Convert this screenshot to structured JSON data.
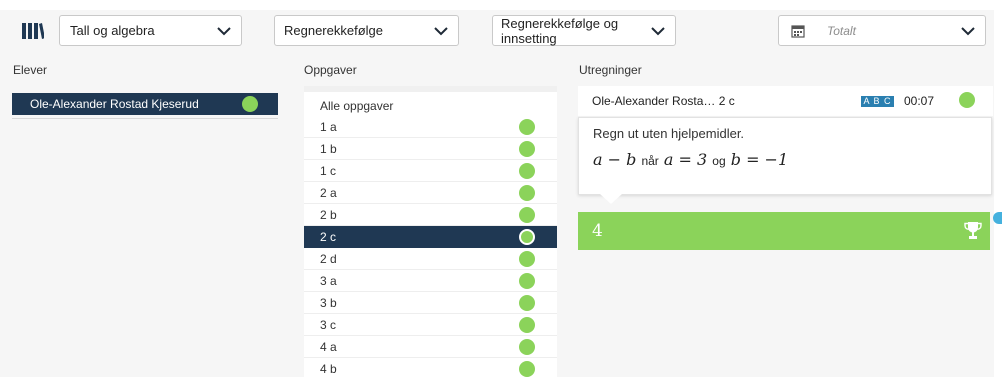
{
  "toolbar": {
    "subject": "Tall og algebra",
    "topic": "Regnerekkefølge",
    "subtopic": "Regnerekkefølge og innsetting",
    "period_placeholder": "Totalt"
  },
  "headers": {
    "students": "Elever",
    "tasks": "Oppgaver",
    "calculations": "Utregninger"
  },
  "students": [
    {
      "name": "Ole-Alexander Rostad Kjeserud",
      "status": "correct"
    }
  ],
  "tasks": {
    "all_label": "Alle oppgaver",
    "selected": "2 c",
    "items": [
      "1 a",
      "1 b",
      "1 c",
      "2 a",
      "2 b",
      "2 c",
      "2 d",
      "3 a",
      "3 b",
      "3 c",
      "4 a",
      "4 b"
    ]
  },
  "calculation": {
    "student_task": "Ole-Alexander Rosta… 2 c",
    "input_mode_badge": "A B C",
    "time": "00:07",
    "question_text": "Regn ut uten hjelpemidler.",
    "question_math": {
      "expr": "a − b",
      "word_when": "når",
      "cond1": "a = 3",
      "word_and": "og",
      "cond2": "b = −1"
    },
    "answer": "4"
  },
  "colors": {
    "navy": "#1f3853",
    "green": "#8bd35a",
    "badge_blue": "#2a7fb0",
    "accent_blue": "#45b1de"
  },
  "icons": {
    "library": "library-books-icon",
    "chevron": "chevron-down-icon",
    "calendar": "calendar-icon",
    "status": "status-dot-icon",
    "trophy": "trophy-icon"
  }
}
